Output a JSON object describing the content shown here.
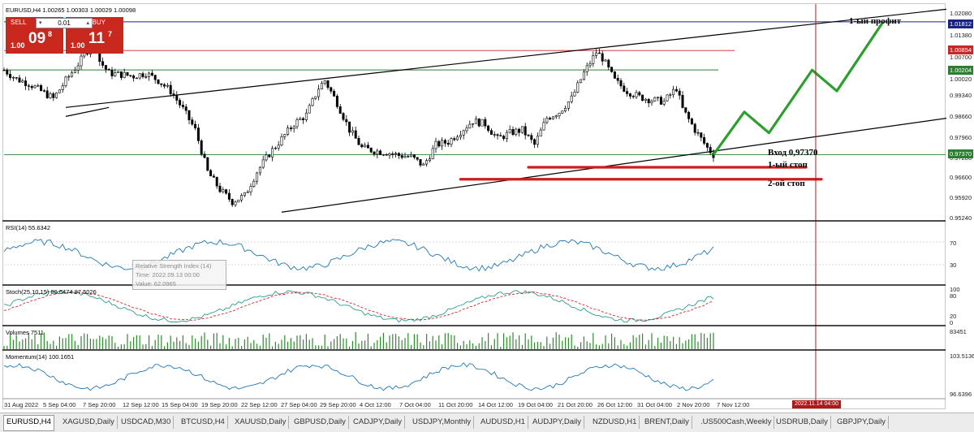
{
  "window": {
    "title": "EURUSD,H4  1.00265 1.00303 1.00029 1.00098"
  },
  "trade_panel": {
    "sell_label": "SELL",
    "buy_label": "BUY",
    "lot_value": "0.01",
    "sell_price_prefix": "1.00",
    "sell_price_big": "09",
    "sell_price_sup": "8",
    "buy_price_prefix": "1.00",
    "buy_price_big": "11",
    "buy_price_sup": "7",
    "colors": {
      "sell": "#c8281e",
      "buy": "#c8281e"
    }
  },
  "price_axis": {
    "ticks": [
      "1.02080",
      "1.01380",
      "1.00700",
      "1.00020",
      "0.99340",
      "0.98660",
      "0.97960",
      "0.97280",
      "0.96600",
      "0.95920",
      "0.95240"
    ],
    "tags": [
      {
        "label": "1.01812",
        "color": "#1a237e"
      },
      {
        "label": "1.00854",
        "color": "#c62828"
      },
      {
        "label": "1.00204",
        "color": "#2e7d32"
      },
      {
        "label": "0.97370",
        "color": "#2e7d32"
      }
    ]
  },
  "annotations": {
    "profit_1": "1-ый профит",
    "entry": "Вход 0,97370",
    "stop_1": "1-ый стоп",
    "stop_2": "2-ой стоп"
  },
  "indicators": {
    "rsi": {
      "label": "RSI(14) 55.6342",
      "ticks": [
        "70",
        "30"
      ]
    },
    "stoch": {
      "label": "Stoch(25,10,15) 89.6474 87.5026",
      "ticks": [
        "100",
        "80",
        "20",
        "0"
      ]
    },
    "volumes": {
      "label": "Volumes 7511",
      "ticks": [
        "83451"
      ]
    },
    "momentum": {
      "label": "Momentum(14) 100.1651",
      "ticks": [
        "103.5136",
        "96.6396"
      ]
    },
    "tooltip": {
      "title": "Relative Strength Index (14)",
      "time": "Time: 2022.09.13 00:00",
      "value": "Value: 62.0965"
    }
  },
  "time_axis": {
    "labels": [
      "31 Aug 2022",
      "5 Sep 04:00",
      "7 Sep 20:00",
      "12 Sep 12:00",
      "15 Sep 04:00",
      "19 Sep 20:00",
      "22 Sep 12:00",
      "27 Sep 04:00",
      "29 Sep 20:00",
      "4 Oct 12:00",
      "7 Oct 04:00",
      "11 Oct 20:00",
      "14 Oct 12:00",
      "19 Oct 04:00",
      "21 Oct 20:00",
      "26 Oct 12:00",
      "31 Oct 04:00",
      "2 Nov 20:00",
      "7 Nov 12:00"
    ],
    "cursor_label": "2022.11.14 04:00"
  },
  "tabs": [
    "EURUSD,H4",
    "XAGUSD,Daily",
    "USDCAD,M30",
    "BTCUSD,H4",
    "XAUUSD,Daily",
    "GBPUSD,Daily",
    "CADJPY,Daily",
    "USDJPY,Monthly",
    "AUDUSD,H1",
    "AUDJPY,Daily",
    "NZDUSD,H1",
    "BRENT,Daily",
    ".US500Cash,Weekly",
    "USDRUB,Daily",
    "GBPJPY,Daily"
  ],
  "active_tab": "EURUSD,H4",
  "chart_data": {
    "type": "candlestick",
    "symbol": "EURUSD",
    "timeframe": "H4",
    "ylim": [
      0.9524,
      1.0208
    ],
    "ohlc_last": {
      "open": 1.00265,
      "high": 1.00303,
      "low": 1.00029,
      "close": 1.00098
    },
    "close_path": [
      [
        0,
        1.002
      ],
      [
        4,
        0.999
      ],
      [
        8,
        0.9975
      ],
      [
        12,
        0.995
      ],
      [
        16,
        0.9925
      ],
      [
        20,
        0.9985
      ],
      [
        24,
        1.004
      ],
      [
        28,
        1.01
      ],
      [
        30,
        1.017
      ],
      [
        31,
        1.005
      ],
      [
        34,
        1.001
      ],
      [
        38,
        1.0005
      ],
      [
        42,
        1.0
      ],
      [
        46,
        1.001
      ],
      [
        50,
        0.9985
      ],
      [
        54,
        0.995
      ],
      [
        58,
        0.989
      ],
      [
        62,
        0.982
      ],
      [
        66,
        0.968
      ],
      [
        70,
        0.962
      ],
      [
        74,
        0.958
      ],
      [
        78,
        0.96
      ],
      [
        82,
        0.968
      ],
      [
        86,
        0.974
      ],
      [
        90,
        0.979
      ],
      [
        94,
        0.984
      ],
      [
        98,
        0.987
      ],
      [
        102,
        0.996
      ],
      [
        104,
        0.9985
      ],
      [
        108,
        0.991
      ],
      [
        112,
        0.982
      ],
      [
        116,
        0.976
      ],
      [
        120,
        0.975
      ],
      [
        124,
        0.9745
      ],
      [
        128,
        0.9735
      ],
      [
        132,
        0.973
      ],
      [
        136,
        0.97
      ],
      [
        140,
        0.977
      ],
      [
        144,
        0.978
      ],
      [
        148,
        0.9815
      ],
      [
        152,
        0.985
      ],
      [
        156,
        0.984
      ],
      [
        160,
        0.979
      ],
      [
        164,
        0.981
      ],
      [
        168,
        0.982
      ],
      [
        172,
        0.977
      ],
      [
        176,
        0.986
      ],
      [
        180,
        0.988
      ],
      [
        184,
        0.9925
      ],
      [
        188,
        1.001
      ],
      [
        192,
        1.008
      ],
      [
        194,
        1.006
      ],
      [
        198,
        0.9985
      ],
      [
        202,
        0.995
      ],
      [
        206,
        0.993
      ],
      [
        210,
        0.992
      ],
      [
        214,
        0.9915
      ],
      [
        218,
        0.996
      ],
      [
        220,
        0.989
      ],
      [
        224,
        0.982
      ],
      [
        228,
        0.976
      ],
      [
        230,
        0.9737
      ]
    ],
    "horizontal_levels": [
      {
        "price": 1.01812,
        "color": "#1a237e"
      },
      {
        "price": 1.00854,
        "color": "#c62828"
      },
      {
        "price": 1.00204,
        "color": "#2e7d32"
      },
      {
        "price": 0.9737,
        "color": "#2e7d32"
      }
    ],
    "projection": [
      [
        230,
        0.9737
      ],
      [
        240,
        0.988
      ],
      [
        248,
        0.981
      ],
      [
        262,
        1.002
      ],
      [
        270,
        0.995
      ],
      [
        285,
        1.0181
      ]
    ],
    "stops": [
      {
        "from": 170,
        "to": 260,
        "price": 0.9695
      },
      {
        "from": 148,
        "to": 265,
        "price": 0.9655
      }
    ],
    "channel": {
      "upper": [
        [
          20,
          0.9895
        ],
        [
          320,
          1.024
        ]
      ],
      "lower": [
        [
          90,
          0.9545
        ],
        [
          320,
          0.988
        ]
      ],
      "low_tag": [
        [
          20,
          0.9865
        ],
        [
          34,
          0.9895
        ]
      ]
    }
  }
}
